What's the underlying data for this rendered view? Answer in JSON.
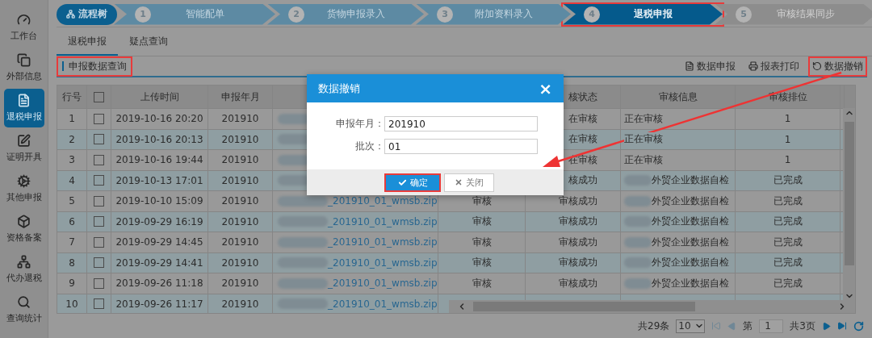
{
  "sidebar": {
    "items": [
      {
        "label": "工作台",
        "selected": false
      },
      {
        "label": "外部信息",
        "selected": false
      },
      {
        "label": "退税申报",
        "selected": true
      },
      {
        "label": "证明开具",
        "selected": false
      },
      {
        "label": "其他申报",
        "selected": false
      },
      {
        "label": "资格备案",
        "selected": false
      },
      {
        "label": "代办退税",
        "selected": false
      },
      {
        "label": "查询统计",
        "selected": false
      }
    ]
  },
  "flow": {
    "root": "流程树",
    "steps": [
      {
        "number": "1",
        "label": "智能配单",
        "selected": false,
        "disabled": false,
        "highlighted": false
      },
      {
        "number": "2",
        "label": "货物申报录入",
        "selected": false,
        "disabled": false,
        "highlighted": false
      },
      {
        "number": "3",
        "label": "附加资料录入",
        "selected": false,
        "disabled": false,
        "highlighted": false
      },
      {
        "number": "4",
        "label": "退税申报",
        "selected": true,
        "disabled": false,
        "highlighted": true
      },
      {
        "number": "5",
        "label": "审核结果同步",
        "selected": false,
        "disabled": true,
        "highlighted": false
      }
    ]
  },
  "tabs": [
    {
      "label": "退税申报",
      "selected": true
    },
    {
      "label": "疑点查询",
      "selected": false
    }
  ],
  "section": {
    "title": "申报数据查询",
    "highlighted": true
  },
  "toolbar": [
    {
      "label": "数据申报",
      "highlighted": false
    },
    {
      "label": "报表打印",
      "highlighted": false
    },
    {
      "label": "数据撤销",
      "highlighted": true
    }
  ],
  "table": {
    "columns": [
      "行号",
      "",
      "上传时间",
      "申报年月",
      "",
      "",
      "核状态",
      "审核信息",
      "审核排位"
    ],
    "header_checked": false,
    "rows": [
      {
        "no": "1",
        "checked": false,
        "time": "2019-10-16 20:20",
        "month": "201910",
        "file": {
          "redacted": true
        },
        "status": "在审核",
        "info": {
          "text": "正在审核"
        },
        "rank": "1"
      },
      {
        "no": "2",
        "checked": false,
        "time": "2019-10-16 20:13",
        "month": "201910",
        "file": {
          "redacted": true
        },
        "status": "在审核",
        "info": {
          "text": "正在审核"
        },
        "rank": "1"
      },
      {
        "no": "3",
        "checked": false,
        "time": "2019-10-16 19:44",
        "month": "201910",
        "file": {
          "redacted": true
        },
        "status": "在审核",
        "info": {
          "text": "正在审核"
        },
        "rank": "1"
      },
      {
        "no": "4",
        "checked": false,
        "time": "2019-10-13 17:01",
        "month": "201910",
        "file": {
          "redacted": true
        },
        "status": "核成功",
        "info": {
          "text": "外贸企业数据自检",
          "redacted": true
        },
        "rank": "已完成"
      },
      {
        "no": "5",
        "checked": false,
        "time": "2019-10-10 15:09",
        "month": "201910",
        "file": {
          "text": "_201910_01_wmsb.zip",
          "redacted": true
        },
        "type": "审核",
        "status": "审核成功",
        "info": {
          "text": "外贸企业数据自检",
          "redacted": true
        },
        "rank": "已完成"
      },
      {
        "no": "6",
        "checked": false,
        "time": "2019-09-29 16:19",
        "month": "201910",
        "file": {
          "text": "_201910_01_wmsb.zip",
          "redacted": true
        },
        "type": "审核",
        "status": "审核成功",
        "info": {
          "text": "外贸企业数据自检",
          "redacted": true
        },
        "rank": "已完成"
      },
      {
        "no": "7",
        "checked": false,
        "time": "2019-09-29 14:45",
        "month": "201910",
        "file": {
          "text": "_201910_01_wmsb.zip",
          "redacted": true
        },
        "type": "审核",
        "status": "审核成功",
        "info": {
          "text": "外贸企业数据自检",
          "redacted": true
        },
        "rank": "已完成"
      },
      {
        "no": "8",
        "checked": false,
        "time": "2019-09-29 14:41",
        "month": "201910",
        "file": {
          "text": "_201910_01_wmsb.zip",
          "redacted": true
        },
        "type": "审核",
        "status": "审核成功",
        "info": {
          "text": "外贸企业数据自检",
          "redacted": true
        },
        "rank": "已完成"
      },
      {
        "no": "9",
        "checked": false,
        "time": "2019-09-26 11:18",
        "month": "201910",
        "file": {
          "text": "_201910_01_wmsb.zip",
          "redacted": true
        },
        "type": "审核",
        "status": "审核成功",
        "info": {
          "text": "外贸企业数据自检",
          "redacted": true
        },
        "rank": "已完成"
      },
      {
        "no": "10",
        "checked": false,
        "time": "2019-09-26 11:17",
        "month": "201910",
        "file": {
          "text": "_201910_01_wmsb.zip",
          "redacted": true
        }
      }
    ]
  },
  "pagination": {
    "total": "共29条",
    "page_size": "10",
    "page_label": "第",
    "page": "1",
    "pages": "共3页"
  },
  "dialog": {
    "title": "数据撤销",
    "close": "×",
    "fields": [
      {
        "label": "申报年月：",
        "value": "201910"
      },
      {
        "label": "批次：",
        "value": "01"
      }
    ],
    "buttons": [
      {
        "label": "确定",
        "kind": "primary",
        "highlighted": true
      },
      {
        "label": "关闭",
        "kind": "secondary",
        "highlighted": false
      }
    ]
  }
}
